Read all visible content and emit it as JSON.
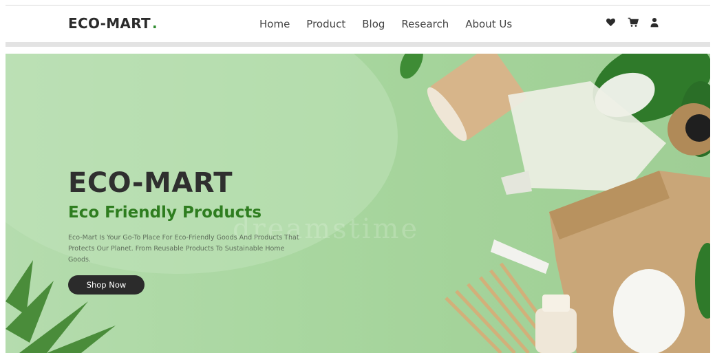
{
  "brand": {
    "name": "ECO-MART",
    "dot": "."
  },
  "nav": {
    "links": [
      "Home",
      "Product",
      "Blog",
      "Research",
      "About Us"
    ],
    "icons": [
      "heart-icon",
      "cart-icon",
      "user-icon"
    ]
  },
  "hero": {
    "title": "ECO-MART",
    "subtitle": "Eco Friendly Products",
    "description": "Eco-Mart Is Your Go-To Place For Eco-Friendly Goods And Products That Protects Our Planet. From Reusable Products To Sustainable Home Goods.",
    "button_label": "Shop Now",
    "watermark": "dreamstime"
  },
  "colors": {
    "accent_green": "#2e8b2e",
    "subtitle_green": "#2e7d1f",
    "button_dark": "#2b2b2b",
    "hero_bg": "#a9d7a0"
  }
}
